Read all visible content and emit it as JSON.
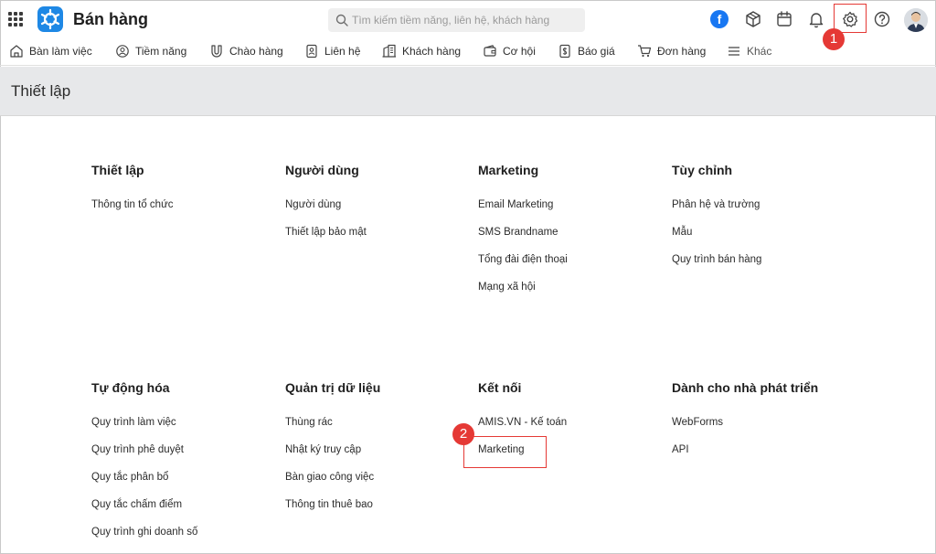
{
  "app": {
    "title": "Bán hàng"
  },
  "search": {
    "placeholder": "Tìm kiếm tiềm năng, liên hệ, khách hàng"
  },
  "topbar": {
    "facebook_glyph": "f",
    "annotation_1": "1",
    "annotation_2": "2"
  },
  "nav": [
    {
      "label": "Bàn làm việc",
      "icon": "home-icon"
    },
    {
      "label": "Tiềm năng",
      "icon": "lead-icon"
    },
    {
      "label": "Chào hàng",
      "icon": "magnet-icon"
    },
    {
      "label": "Liên hệ",
      "icon": "contact-icon"
    },
    {
      "label": "Khách hàng",
      "icon": "building-icon"
    },
    {
      "label": "Cơ hội",
      "icon": "wallet-icon"
    },
    {
      "label": "Báo giá",
      "icon": "quote-icon"
    },
    {
      "label": "Đơn hàng",
      "icon": "cart-icon"
    },
    {
      "label": "Khác",
      "icon": "menu-icon"
    }
  ],
  "page": {
    "title": "Thiết lập"
  },
  "sections": [
    {
      "title": "Thiết lập",
      "items": [
        "Thông tin tổ chức"
      ]
    },
    {
      "title": "Người dùng",
      "items": [
        "Người dùng",
        "Thiết lập bảo mật"
      ]
    },
    {
      "title": "Marketing",
      "items": [
        "Email Marketing",
        "SMS Brandname",
        "Tổng đài điện thoại",
        "Mạng xã hội"
      ]
    },
    {
      "title": "Tùy chỉnh",
      "items": [
        "Phân hệ và trường",
        "Mẫu",
        "Quy trình bán hàng"
      ]
    },
    {
      "title": "Tự động hóa",
      "items": [
        "Quy trình làm việc",
        "Quy trình phê duyệt",
        "Quy tắc phân bổ",
        "Quy tắc chấm điểm",
        "Quy trình ghi doanh số"
      ]
    },
    {
      "title": "Quản trị dữ liệu",
      "items": [
        "Thùng rác",
        "Nhật ký truy cập",
        "Bàn giao công việc",
        "Thông tin thuê bao"
      ]
    },
    {
      "title": "Kết nối",
      "items": [
        "AMIS.VN - Kế toán",
        "Marketing"
      ]
    },
    {
      "title": "Dành cho nhà phát triển",
      "items": [
        "WebForms",
        "API"
      ]
    }
  ],
  "colors": {
    "brand": "#1e88e5",
    "highlight": "#e53935",
    "header_bg": "#e7e8ea",
    "facebook": "#1877f2"
  }
}
